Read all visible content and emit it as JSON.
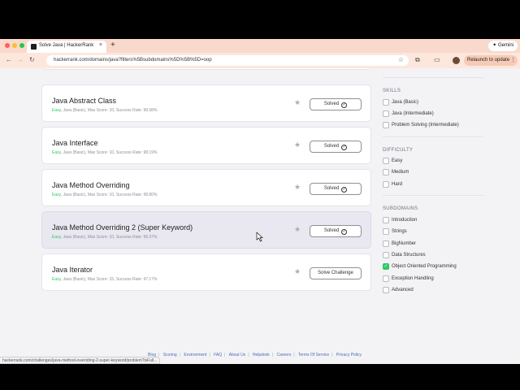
{
  "browser": {
    "tab_title": "Solve Java | HackerRank",
    "tab_close": "×",
    "new_tab": "+",
    "gemini_label": "✦ Gemini",
    "back": "←",
    "forward": "→",
    "reload": "↻",
    "url": "hackerrank.com/domains/java?filters%5Bsubdomains%5D%5B%5D=oop",
    "bookmark_icon": "☆",
    "extensions_icon": "⧉",
    "cast_icon": "▭",
    "relaunch_label": "Relaunch to update",
    "menu_icon": "⋮",
    "status_url": "hackerrank.com/challenges/java-method-overriding-2-super-keyword/problem?isFull..."
  },
  "challenges": [
    {
      "title": "Java Abstract Class",
      "difficulty": "Easy",
      "meta": ", Java (Basic), Max Score: 10, Success Rate: 98.58%",
      "action": "Solved",
      "solved": true
    },
    {
      "title": "Java Interface",
      "difficulty": "Easy",
      "meta": ", Java (Basic), Max Score: 10, Success Rate: 98.19%",
      "action": "Solved",
      "solved": true
    },
    {
      "title": "Java Method Overriding",
      "difficulty": "Easy",
      "meta": ", Java (Basic), Max Score: 10, Success Rate: 98.80%",
      "action": "Solved",
      "solved": true
    },
    {
      "title": "Java Method Overriding 2 (Super Keyword)",
      "difficulty": "Easy",
      "meta": ", Java (Basic), Max Score: 10, Success Rate: 99.37%",
      "action": "Solved",
      "solved": true
    },
    {
      "title": "Java Iterator",
      "difficulty": "Easy",
      "meta": ", Java (Basic), Max Score: 15, Success Rate: 97.17%",
      "action": "Solve Challenge",
      "solved": false
    }
  ],
  "filters": {
    "skills_heading": "SKILLS",
    "skills": [
      "Java (Basic)",
      "Java (Intermediate)",
      "Problem Solving (Intermediate)"
    ],
    "difficulty_heading": "DIFFICULTY",
    "difficulty": [
      "Easy",
      "Medium",
      "Hard"
    ],
    "subdomains_heading": "SUBDOMAINS",
    "subdomains": [
      "Introduction",
      "Strings",
      "BigNumber",
      "Data Structures",
      "Object Oriented Programming",
      "Exception Handling",
      "Advanced"
    ],
    "checked_subdomain": "Object Oriented Programming"
  },
  "footer": [
    "Blog",
    "Scoring",
    "Environment",
    "FAQ",
    "About Us",
    "Helpdesk",
    "Careers",
    "Terms Of Service",
    "Privacy Policy"
  ],
  "colors": {
    "accent_green": "#2ec866",
    "tab_bar": "#f8d9cc",
    "toolbar": "#fde7dc"
  }
}
